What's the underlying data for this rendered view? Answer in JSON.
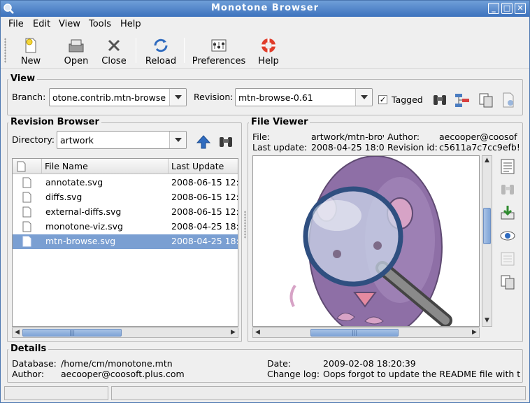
{
  "window": {
    "title": "Monotone Browser"
  },
  "menu": {
    "file": "File",
    "edit": "Edit",
    "view": "View",
    "tools": "Tools",
    "help": "Help"
  },
  "toolbar": {
    "new": "New",
    "open": "Open",
    "close": "Close",
    "reload": "Reload",
    "preferences": "Preferences",
    "help": "Help"
  },
  "view_section": {
    "title": "View",
    "branch_label": "Branch:",
    "branch_value": "otone.contrib.mtn-browse",
    "revision_label": "Revision:",
    "revision_value": "mtn-browse-0.61",
    "tagged_label": "Tagged",
    "tagged_checked": true
  },
  "revision_browser": {
    "title": "Revision Browser",
    "directory_label": "Directory:",
    "directory_value": "artwork",
    "columns": [
      "File Name",
      "Last Update"
    ],
    "files": [
      {
        "name": "annotate.svg",
        "date": "2008-06-15 12:"
      },
      {
        "name": "diffs.svg",
        "date": "2008-06-15 12:"
      },
      {
        "name": "external-diffs.svg",
        "date": "2008-06-15 12:"
      },
      {
        "name": "monotone-viz.svg",
        "date": "2008-04-25 18:"
      },
      {
        "name": "mtn-browse.svg",
        "date": "2008-04-25 18:"
      }
    ],
    "selected_index": 4
  },
  "file_viewer": {
    "title": "File Viewer",
    "file_label": "File:",
    "file_value": "artwork/mtn-brov",
    "author_label": "Author:",
    "author_value": "aecooper@coosof",
    "update_label": "Last update:",
    "update_value": "2008-04-25 18:0",
    "revid_label": "Revision id:",
    "revid_value": "c5611a7c7cc9efb!"
  },
  "details": {
    "title": "Details",
    "database_label": "Database:",
    "database_value": "/home/cm/monotone.mtn",
    "author_label": "Author:",
    "author_value": "aecooper@coosoft.plus.com",
    "date_label": "Date:",
    "date_value": "2009-02-08 18:20:39",
    "changelog_label": "Change log:",
    "changelog_value": "Oops forgot to update the README file with t"
  },
  "colors": {
    "accent": "#3d72bd",
    "selection": "#7a9fd2"
  }
}
